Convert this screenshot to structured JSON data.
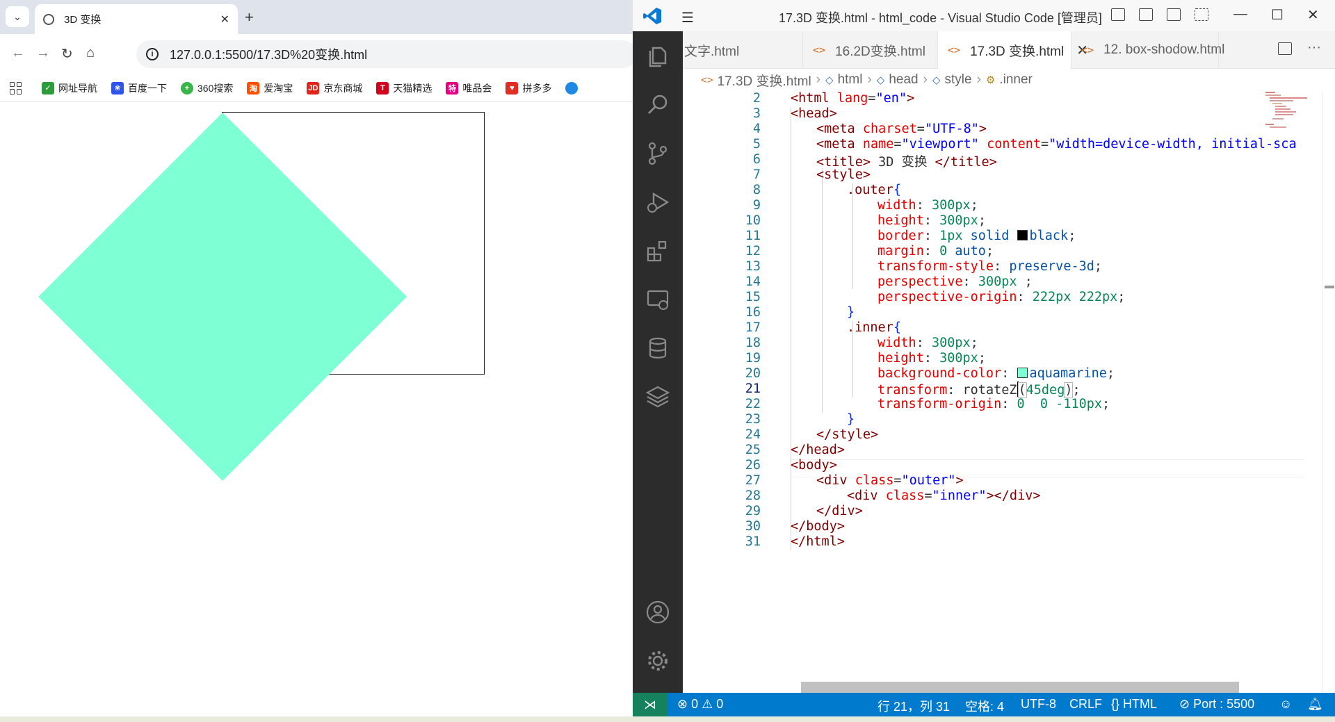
{
  "browser": {
    "tab_title": "3D 变换",
    "url": "127.0.0.1:5500/17.3D%20变换.html",
    "bookmarks": [
      {
        "label": "网址导航",
        "icon": "hao-icon",
        "color": "#2a9d3a"
      },
      {
        "label": "百度一下",
        "icon": "baidu-paw-icon",
        "color": "#2f54eb"
      },
      {
        "label": "360搜索",
        "icon": "360-search-icon",
        "color": "#3bb54a"
      },
      {
        "label": "爱淘宝",
        "icon": "taobao-icon",
        "color": "#ff5000"
      },
      {
        "label": "京东商城",
        "icon": "jd-icon",
        "color": "#e1251b"
      },
      {
        "label": "天猫精选",
        "icon": "tmall-icon",
        "color": "#d3001d"
      },
      {
        "label": "唯品会",
        "icon": "vip-icon",
        "color": "#e5007f"
      },
      {
        "label": "拼多多",
        "icon": "pinduoduo-icon",
        "color": "#e02e24"
      }
    ],
    "page": {
      "outer_border_color": "#000000",
      "inner_color": "#7fffd4"
    }
  },
  "vscode": {
    "window_title": "17.3D 变换.html - html_code - Visual Studio Code [管理员]",
    "tabs": [
      {
        "label": "文字.html",
        "active": false
      },
      {
        "label": "16.2D变换.html",
        "active": false
      },
      {
        "label": "17.3D 变换.html",
        "active": true
      },
      {
        "label": "12. box-shodow.html",
        "active": false
      }
    ],
    "breadcrumbs": [
      "17.3D 变换.html",
      "html",
      "head",
      "style",
      ".inner"
    ],
    "line_numbers": [
      "2",
      "3",
      "4",
      "5",
      "6",
      "7",
      "8",
      "9",
      "10",
      "11",
      "12",
      "13",
      "14",
      "15",
      "16",
      "17",
      "18",
      "19",
      "20",
      "21",
      "22",
      "23",
      "24",
      "25",
      "26",
      "27",
      "28",
      "29",
      "30",
      "31"
    ],
    "current_line": "21",
    "code": {
      "l2_a": "<html ",
      "l2_attr": "lang",
      "l2_eq": "=",
      "l2_val": "\"en\"",
      "l2_b": ">",
      "l3": "<head>",
      "l4_a": "<meta ",
      "l4_attr": "charset",
      "l4_eq": "=",
      "l4_val": "\"UTF-8\"",
      "l4_b": ">",
      "l5_a": "<meta ",
      "l5_attr1": "name",
      "l5_eq1": "=",
      "l5_val1": "\"viewport\"",
      "l5_sp": " ",
      "l5_attr2": "content",
      "l5_eq2": "=",
      "l5_val2": "\"width=device-width, initial-sca",
      "l6_a": "<title>",
      "l6_text": " 3D 变换 ",
      "l6_b": "</title>",
      "l7": "<style>",
      "l8_sel": ".outer",
      "l8_brace": "{",
      "l9_prop": "width",
      "l9_colon": ": ",
      "l9_val": "300px",
      "l9_end": ";",
      "l10_prop": "height",
      "l10_colon": ": ",
      "l10_val": "300px",
      "l10_end": ";",
      "l11_prop": "border",
      "l11_colon": ": ",
      "l11_num": "1px",
      "l11_kw": " solid ",
      "l11_color": "black",
      "l11_end": ";",
      "l12_prop": "margin",
      "l12_colon": ": ",
      "l12_num": "0",
      "l12_kw": " auto",
      "l12_end": ";",
      "l13_prop": "transform-style",
      "l13_colon": ": ",
      "l13_val": "preserve-3d",
      "l13_end": ";",
      "l14_prop": "perspective",
      "l14_colon": ": ",
      "l14_val": "300px",
      "l14_end": " ;",
      "l15_prop": "perspective-origin",
      "l15_colon": ": ",
      "l15_val": "222px 222px",
      "l15_end": ";",
      "l16": "}",
      "l17_sel": ".inner",
      "l17_brace": "{",
      "l18_prop": "width",
      "l18_colon": ": ",
      "l18_val": "300px",
      "l18_end": ";",
      "l19_prop": "height",
      "l19_colon": ": ",
      "l19_val": "300px",
      "l19_end": ";",
      "l20_prop": "background-color",
      "l20_colon": ": ",
      "l20_val": "aquamarine",
      "l20_end": ";",
      "l21_prop": "transform",
      "l21_colon": ": ",
      "l21_fn": "rotateZ",
      "l21_open": "(",
      "l21_val": "45deg",
      "l21_close": ")",
      "l21_end": ";",
      "l22_prop": "transform-origin",
      "l22_colon": ": ",
      "l22_val": "0  0 -110px",
      "l22_end": ";",
      "l23": "}",
      "l24": "</style>",
      "l25": "</head>",
      "l26": "<body>",
      "l27_a": "<div ",
      "l27_attr": "class",
      "l27_eq": "=",
      "l27_val": "\"outer\"",
      "l27_b": ">",
      "l28_a": "<div ",
      "l28_attr": "class",
      "l28_eq": "=",
      "l28_val": "\"inner\"",
      "l28_b": "></div>",
      "l29": "</div>",
      "l30": "</body>",
      "l31": "</html>"
    },
    "status": {
      "errors": "0",
      "warnings": "0",
      "position": "行 21，列 31",
      "spaces": "空格: 4",
      "encoding": "UTF-8",
      "eol": "CRLF",
      "language": "HTML",
      "port": "Port : 5500"
    },
    "colors": {
      "accent": "#007acc",
      "remote": "#16825d",
      "activity_bar": "#2c2c2c"
    }
  }
}
